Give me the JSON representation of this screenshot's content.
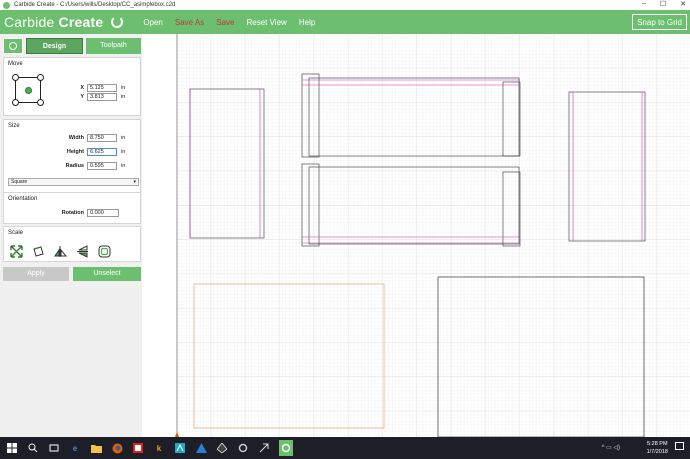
{
  "window": {
    "title": "Carbide Create - C:/Users/wills/Desktop/CC_asimplebox.c2d",
    "minimize": "–",
    "maximize": "☐",
    "close": "✕"
  },
  "toolbar": {
    "brand_light": "Carbide ",
    "brand_bold": "Create",
    "menu": [
      "Open",
      "Save As",
      "Save",
      "Reset View",
      "Help"
    ],
    "snap_label": "Snap to Grid"
  },
  "tabs": {
    "design": "Design",
    "toolpath": "Toolpath"
  },
  "move": {
    "heading": "Move",
    "x_label": "X",
    "x_value": "5.125",
    "y_label": "Y",
    "y_value": "3.813",
    "unit": "in"
  },
  "size": {
    "heading": "Size",
    "width_label": "Width",
    "width_value": "8.750",
    "height_label": "Height",
    "height_value": "6.625",
    "radius_label": "Radius",
    "radius_value": "0.595",
    "unit": "in",
    "corner_type": "Square"
  },
  "orientation": {
    "heading": "Orientation",
    "rotation_label": "Rotation",
    "rotation_value": "0.000"
  },
  "scale": {
    "heading": "Scale"
  },
  "actions": {
    "apply": "Apply",
    "unselect": "Unselect"
  },
  "taskbar": {
    "tray": "^ ▭ ◁)",
    "time": "5:28 PM",
    "date": "1/7/2018"
  },
  "colors": {
    "accent": "#6cbf6f",
    "shape_magenta": "#cc33cc",
    "shape_orange": "#f0a070"
  }
}
